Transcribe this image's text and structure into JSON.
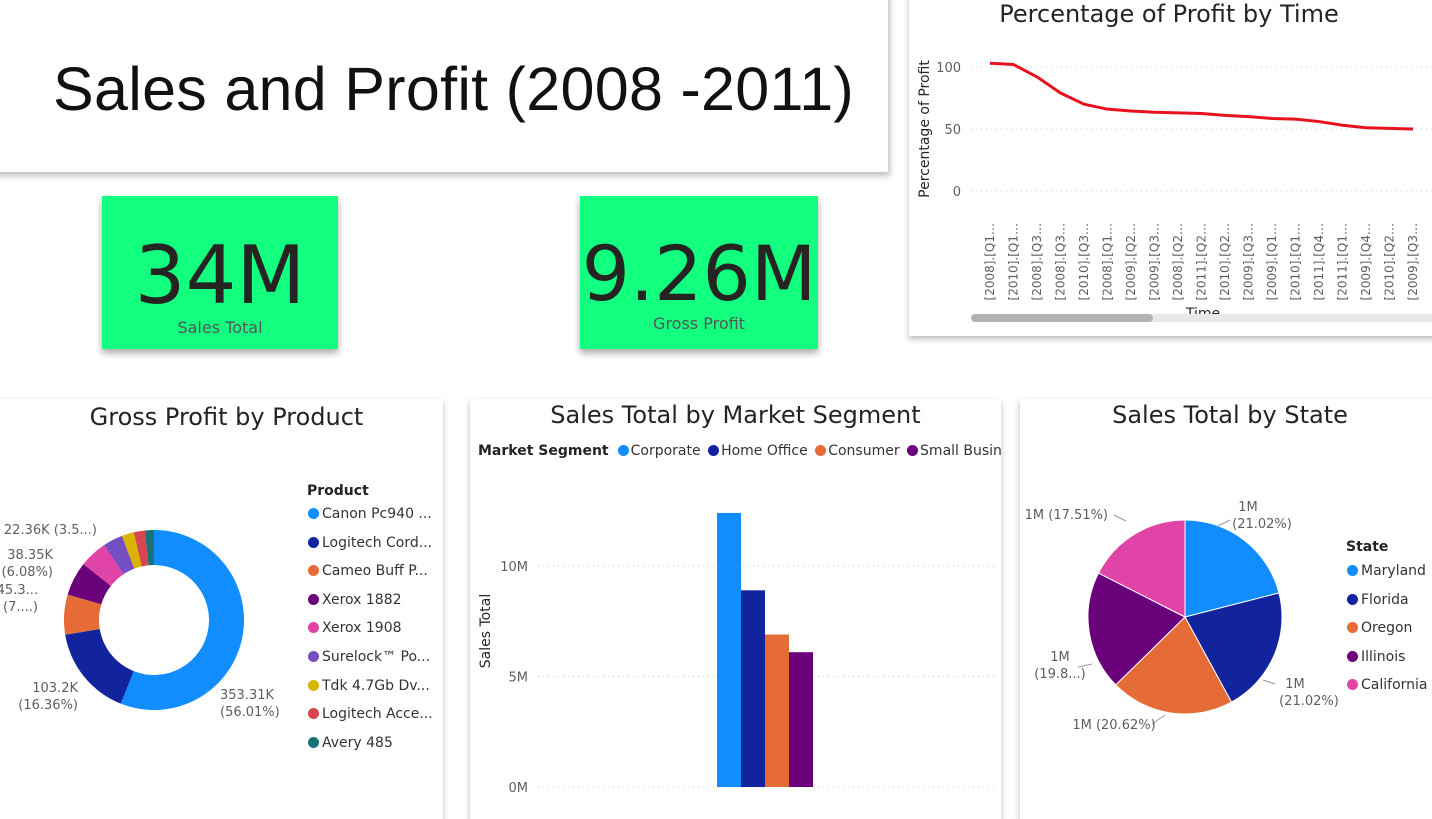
{
  "page": {
    "title": "Sales and Profit (2008 -2011)"
  },
  "kpis": {
    "sales": {
      "value": "34M",
      "label": "Sales Total"
    },
    "profit": {
      "value": "9.26M",
      "label": "Gross Profit"
    }
  },
  "colors": {
    "kpi_background": "#13FF7F",
    "line": "#E8121E",
    "blue": "#118DFF",
    "navy": "#12239E",
    "orange": "#E66C37",
    "purple": "#6B007B",
    "pink": "#E044A7",
    "violet": "#744EC2",
    "gold": "#D9B300",
    "red": "#D64550",
    "teal": "#197278"
  },
  "chart_data": [
    {
      "type": "line",
      "title": "Percentage of Profit by Time",
      "xlabel": "Time",
      "ylabel": "Percentage of Profit",
      "x": [
        "[2008].[Q1…",
        "[2010].[Q1…",
        "[2008].[Q3…",
        "[2008].[Q3…",
        "[2010].[Q3…",
        "[2008].[Q1…",
        "[2009].[Q2…",
        "[2009].[Q3…",
        "[2008].[Q2…",
        "[2011].[Q2…",
        "[2010].[Q2…",
        "[2009].[Q3…",
        "[2009].[Q1…",
        "[2010].[Q1…",
        "[2011].[Q4…",
        "[2011].[Q1…",
        "[2009].[Q4…",
        "[2010].[Q2…",
        "[2009].[Q3…"
      ],
      "values": [
        103,
        102,
        92,
        79,
        70,
        66,
        64.5,
        63.5,
        63,
        62.5,
        61,
        60,
        58.5,
        58,
        56,
        53,
        51,
        50.5,
        50
      ],
      "yticks": [
        100,
        50,
        0
      ],
      "ylim": [
        -10,
        115
      ],
      "grid": true
    },
    {
      "type": "pie",
      "donut": true,
      "title": "Gross Profit by Product",
      "legend_title": "Product",
      "legend_position": "right",
      "series": [
        {
          "name": "Canon Pc940 ...",
          "value": 56.01,
          "label": "353.31K",
          "label2": "(56.01%)",
          "color": "#118DFF"
        },
        {
          "name": "Logitech Cord...",
          "value": 16.36,
          "label": "103.2K",
          "label2": "(16.36%)",
          "color": "#12239E"
        },
        {
          "name": "Cameo Buff P...",
          "value": 7.2,
          "label": "45.3...",
          "label2": "(7....)",
          "color": "#E66C37"
        },
        {
          "name": "Xerox 1882",
          "value": 6.08,
          "label": "38.35K",
          "label2": "(6.08%)",
          "color": "#6B007B"
        },
        {
          "name": "Xerox 1908",
          "value": 5.0,
          "label": "",
          "label2": "",
          "color": "#E044A7"
        },
        {
          "name": "Surelock™ Po...",
          "value": 3.55,
          "label": "22.36K (3.5...)",
          "label2": "",
          "color": "#744EC2"
        },
        {
          "name": "Tdk 4.7Gb Dv...",
          "value": 2.2,
          "label": "",
          "label2": "",
          "color": "#D9B300"
        },
        {
          "name": "Logitech Acce...",
          "value": 2.0,
          "label": "",
          "label2": "",
          "color": "#D64550"
        },
        {
          "name": "Avery 485",
          "value": 1.6,
          "label": "",
          "label2": "",
          "color": "#197278"
        }
      ]
    },
    {
      "type": "bar",
      "title": "Sales Total by Market Segment",
      "legend_title": "Market Segment",
      "legend_position": "top-left",
      "ylabel": "Sales Total",
      "yticks": [
        {
          "value": 10,
          "label": "10M"
        },
        {
          "value": 5,
          "label": "5M"
        },
        {
          "value": 0,
          "label": "0M"
        }
      ],
      "ylim": [
        0,
        14.7
      ],
      "grid": true,
      "series": [
        {
          "name": "Corporate",
          "value": 12.4,
          "color": "#118DFF"
        },
        {
          "name": "Home Office",
          "value": 8.9,
          "color": "#12239E"
        },
        {
          "name": "Consumer",
          "value": 6.9,
          "color": "#E66C37"
        },
        {
          "name": "Small Business",
          "value": 6.1,
          "color": "#6B007B"
        }
      ]
    },
    {
      "type": "pie",
      "title": "Sales Total by State",
      "legend_title": "State",
      "legend_position": "right",
      "series": [
        {
          "name": "Maryland",
          "value": 21.02,
          "label": "1M",
          "label2": "(21.02%)",
          "color": "#118DFF"
        },
        {
          "name": "Florida",
          "value": 21.02,
          "label": "1M",
          "label2": "(21.02%)",
          "color": "#12239E"
        },
        {
          "name": "Oregon",
          "value": 20.62,
          "label": "1M (20.62%)",
          "label2": "",
          "color": "#E66C37"
        },
        {
          "name": "Illinois",
          "value": 19.83,
          "label": "1M",
          "label2": "(19.8...)",
          "color": "#6B007B"
        },
        {
          "name": "California",
          "value": 17.51,
          "label": "1M (17.51%)",
          "label2": "",
          "color": "#E044A7"
        }
      ]
    }
  ]
}
